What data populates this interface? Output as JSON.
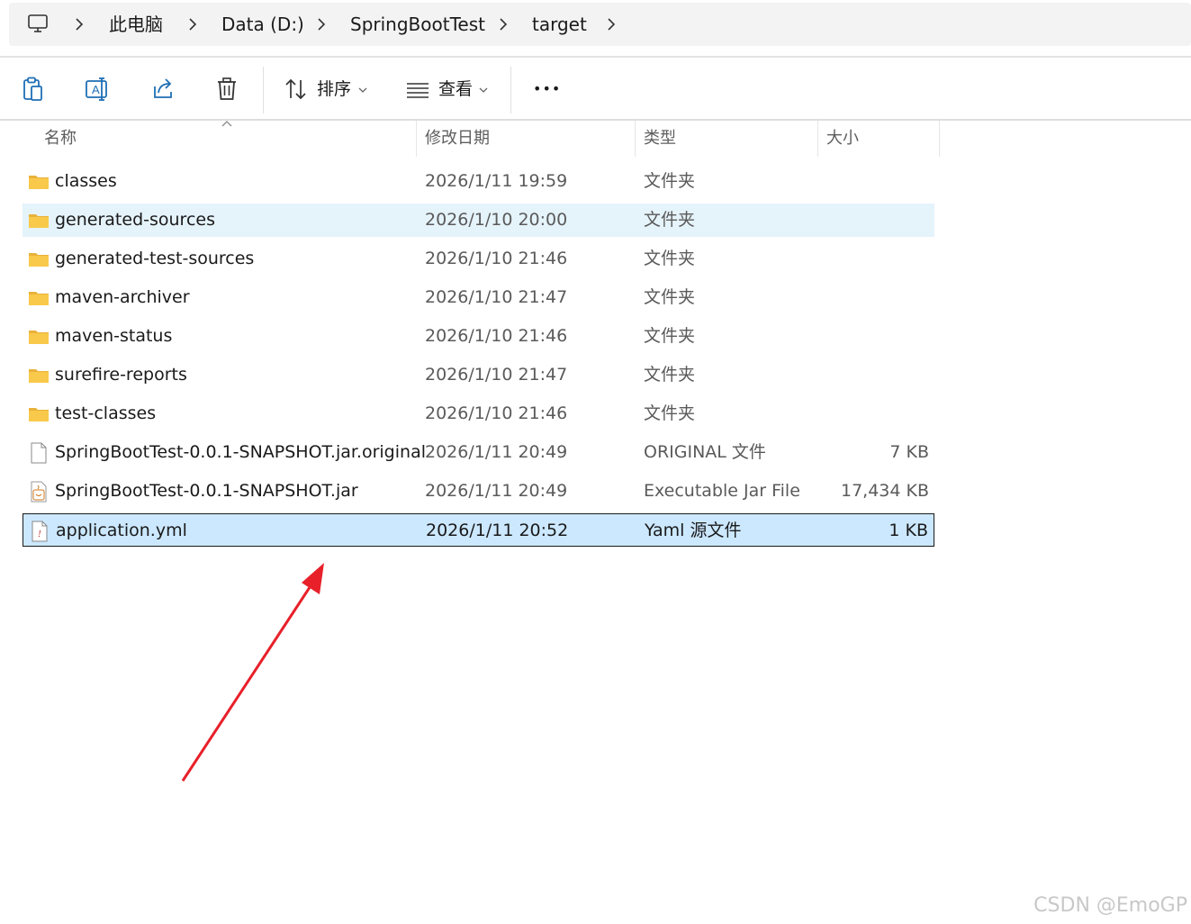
{
  "breadcrumb": {
    "root_icon": "this-pc-icon",
    "items": [
      "此电脑",
      "Data (D:)",
      "SpringBootTest",
      "target"
    ]
  },
  "toolbar": {
    "paste_icon": "clipboard-icon",
    "rename_icon": "rename-icon",
    "share_icon": "share-icon",
    "delete_icon": "trash-icon",
    "sort_label": "排序",
    "view_label": "查看",
    "more_label": "•••"
  },
  "columns": {
    "name": "名称",
    "date": "修改日期",
    "type": "类型",
    "size": "大小"
  },
  "files": [
    {
      "name": "classes",
      "date": "2026/1/11 19:59",
      "type": "文件夹",
      "size": "",
      "icon": "folder-icon"
    },
    {
      "name": "generated-sources",
      "date": "2026/1/10 20:00",
      "type": "文件夹",
      "size": "",
      "icon": "folder-icon"
    },
    {
      "name": "generated-test-sources",
      "date": "2026/1/10 21:46",
      "type": "文件夹",
      "size": "",
      "icon": "folder-icon"
    },
    {
      "name": "maven-archiver",
      "date": "2026/1/10 21:47",
      "type": "文件夹",
      "size": "",
      "icon": "folder-icon"
    },
    {
      "name": "maven-status",
      "date": "2026/1/10 21:46",
      "type": "文件夹",
      "size": "",
      "icon": "folder-icon"
    },
    {
      "name": "surefire-reports",
      "date": "2026/1/10 21:47",
      "type": "文件夹",
      "size": "",
      "icon": "folder-icon"
    },
    {
      "name": "test-classes",
      "date": "2026/1/10 21:46",
      "type": "文件夹",
      "size": "",
      "icon": "folder-icon"
    },
    {
      "name": "SpringBootTest-0.0.1-SNAPSHOT.jar.original",
      "date": "2026/1/11 20:49",
      "type": "ORIGINAL 文件",
      "size": "7 KB",
      "icon": "file-icon"
    },
    {
      "name": "SpringBootTest-0.0.1-SNAPSHOT.jar",
      "date": "2026/1/11 20:49",
      "type": "Executable Jar File",
      "size": "17,434 KB",
      "icon": "jar-file-icon"
    },
    {
      "name": "application.yml",
      "date": "2026/1/11 20:52",
      "type": "Yaml 源文件",
      "size": "1 KB",
      "icon": "yaml-file-icon"
    }
  ],
  "colors": {
    "hover_row": "#e5f3fb",
    "selected_row": "#cce8ff",
    "folder": "#f8c94a",
    "annotation_arrow": "#e8202a"
  },
  "watermark": "CSDN @EmoGP"
}
